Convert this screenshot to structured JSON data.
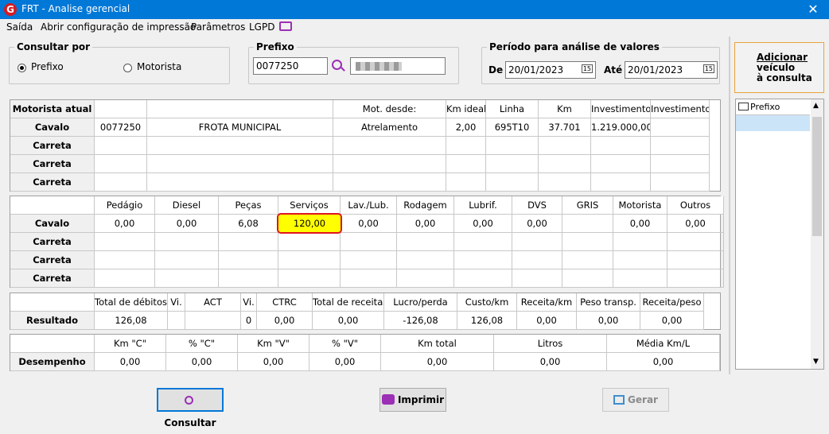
{
  "window": {
    "title": "FRT - Analise gerencial",
    "logo_letter": "G",
    "close_glyph": "✕"
  },
  "menu": {
    "items": [
      "Saída",
      "Abrir configuração de impressão",
      "Parâmetros",
      "LGPD"
    ]
  },
  "consultar": {
    "legend": "Consultar por",
    "opt1": "Prefixo",
    "opt2": "Motorista",
    "selected": "Prefixo"
  },
  "prefixo": {
    "legend": "Prefixo",
    "value": "0077250"
  },
  "periodo": {
    "legend": "Período para análise de valores",
    "de_label": "De",
    "de_value": "20/01/2023",
    "ate_label": "Até",
    "ate_value": "20/01/2023",
    "cal_glyph": "15"
  },
  "add_button": {
    "label_lines": [
      "Adicionar",
      "veículo",
      "à consulta"
    ]
  },
  "side_list": {
    "header": "Prefixo"
  },
  "grid1": {
    "headers": [
      "Motorista atual",
      "",
      "",
      "Mot. desde:",
      "Km ideal",
      "Linha",
      "Km",
      "Investimento",
      "Investimento"
    ],
    "rows": [
      [
        "Cavalo",
        "0077250",
        "FROTA MUNICIPAL",
        "Atrelamento",
        "2,00",
        "695T10",
        "37.701",
        "1.219.000,00",
        ""
      ],
      [
        "Carreta",
        "",
        "",
        "",
        "",
        "",
        "",
        "",
        ""
      ],
      [
        "Carreta",
        "",
        "",
        "",
        "",
        "",
        "",
        "",
        ""
      ],
      [
        "Carreta",
        "",
        "",
        "",
        "",
        "",
        "",
        "",
        ""
      ]
    ]
  },
  "grid2": {
    "headers": [
      "",
      "Pedágio",
      "Diesel",
      "Peças",
      "Serviços",
      "Lav./Lub.",
      "Rodagem",
      "Lubrif.",
      "DVS",
      "GRIS",
      "Motorista",
      "Outros"
    ],
    "rows": [
      [
        "Cavalo",
        "0,00",
        "0,00",
        "6,08",
        "120,00",
        "0,00",
        "0,00",
        "0,00",
        "0,00",
        "",
        "0,00",
        "0,00"
      ],
      [
        "Carreta",
        "",
        "",
        "",
        "",
        "",
        "",
        "",
        "",
        "",
        "",
        ""
      ],
      [
        "Carreta",
        "",
        "",
        "",
        "",
        "",
        "",
        "",
        "",
        "",
        "",
        ""
      ],
      [
        "Carreta",
        "",
        "",
        "",
        "",
        "",
        "",
        "",
        "",
        "",
        "",
        ""
      ]
    ],
    "highlight_color": "#ffff00"
  },
  "grid3": {
    "headers": [
      "",
      "Total de débitos",
      "Vi.",
      "ACT",
      "Vi.",
      "CTRC",
      "Total de receitas",
      "Lucro/perda",
      "Custo/km",
      "Receita/km",
      "Peso transp.",
      "Receita/peso"
    ],
    "row": [
      "Resultado",
      "126,08",
      "",
      "",
      "0",
      "0,00",
      "0,00",
      "-126,08",
      "126,08",
      "0,00",
      "0,00",
      "0,00"
    ]
  },
  "grid4": {
    "headers": [
      "",
      "Km \"C\"",
      "% \"C\"",
      "Km \"V\"",
      "% \"V\"",
      "Km total",
      "Litros",
      "Média Km/L"
    ],
    "row": [
      "Desempenho",
      "0,00",
      "0,00",
      "0,00",
      "0,00",
      "0,00",
      "0,00",
      "0,00"
    ]
  },
  "buttons": {
    "consultar": "Consultar",
    "imprimir": "Imprimir",
    "gerar": "Gerar"
  },
  "colors": {
    "titlebar": "#0078d7",
    "highlight_border": "#e0141e",
    "add_border": "#e8a33c"
  }
}
